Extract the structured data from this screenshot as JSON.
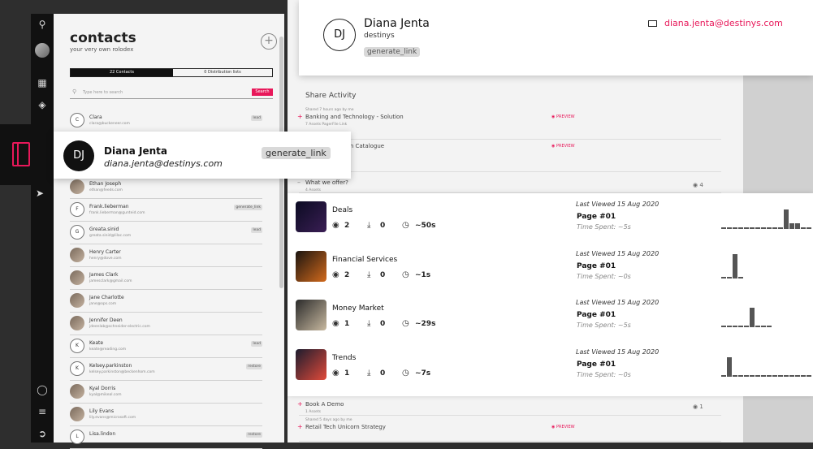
{
  "contacts_panel": {
    "title": "contacts",
    "subtitle": "your very own rolodex",
    "add_icon": "plus-icon",
    "tab_contacts": "22 Contacts",
    "tab_distribution": "0 Distribution lists",
    "search_placeholder": "Type here to search",
    "search_button": "Search",
    "rows": [
      {
        "initial": "C",
        "name": "Clara",
        "email": "clara@buckeneer.com",
        "tag": "lead",
        "photo": false
      },
      {
        "initial": "",
        "name": "Ethan Joseph",
        "email": "ethan@feeds.com",
        "tag": "",
        "photo": true
      },
      {
        "initial": "F",
        "name": "Frank.lieberman",
        "email": "frank.lieberman@gunteid.com",
        "tag": "generate_link",
        "photo": false
      },
      {
        "initial": "G",
        "name": "Greata.sinid",
        "email": "greata.sinid@lilac.com",
        "tag": "lead",
        "photo": false
      },
      {
        "initial": "",
        "name": "Henry Carter",
        "email": "henry@dove.com",
        "tag": "",
        "photo": true
      },
      {
        "initial": "",
        "name": "James Clark",
        "email": "jamesclark@gmail.com",
        "tag": "",
        "photo": true
      },
      {
        "initial": "",
        "name": "Jane Charlotte",
        "email": "jane@ops.com",
        "tag": "",
        "photo": true
      },
      {
        "initial": "",
        "name": "Jennifer Deen",
        "email": "jdeenlab@schneider-electric.com",
        "tag": "",
        "photo": true
      },
      {
        "initial": "K",
        "name": "Keate",
        "email": "keate@reading.com",
        "tag": "lead",
        "photo": false
      },
      {
        "initial": "K",
        "name": "Kelsey.parkinston",
        "email": "kelsey.parkinston@beckenhom.com",
        "tag": "restore",
        "photo": false
      },
      {
        "initial": "",
        "name": "Kyal Dorris",
        "email": "kyal@mikeal.com",
        "tag": "",
        "photo": true
      },
      {
        "initial": "",
        "name": "Lily Evans",
        "email": "lily.evans@microsoft.com",
        "tag": "",
        "photo": true
      },
      {
        "initial": "L",
        "name": "Lisa.lindon",
        "email": "",
        "tag": "restore",
        "photo": false
      }
    ]
  },
  "popup_contact": {
    "initials": "DJ",
    "name": "Diana Jenta",
    "email": "diana.jenta@destinys.com",
    "tag": "generate_link"
  },
  "header": {
    "initials": "DJ",
    "name": "Diana Jenta",
    "company": "destinys",
    "tag": "generate_link",
    "email_icon": "mail-icon",
    "email": "diana.jenta@destinys.com"
  },
  "activity": {
    "heading": "Share Activity",
    "items": [
      {
        "meta": "Shared 7 hours ago by me",
        "title": "Banking and Technology - Solution",
        "sub": "7 Assets    PagerFile Link",
        "preview": "PREVIEW",
        "views": ""
      },
      {
        "meta": "",
        "title": "...eciate - Design Catalogue",
        "sub": "...link",
        "preview": "PREVIEW",
        "views": ""
      },
      {
        "meta": "",
        "title": "What we offer?",
        "sub": "4 Assets",
        "preview": "",
        "views": "4"
      }
    ],
    "bottom_items": [
      {
        "meta": "",
        "title": "Book A Demo",
        "sub": "1 Assets",
        "preview": "",
        "views": "1"
      },
      {
        "meta": "Shared 5 days ago by me",
        "title": "Retail Tech Unicorn Strategy",
        "sub": "",
        "preview": "PREVIEW",
        "views": ""
      }
    ]
  },
  "assets": [
    {
      "name": "Deals",
      "views": "2",
      "downloads": "0",
      "time": "~50s",
      "last_viewed": "Last Viewed 15 Aug 2020",
      "page": "Page #01",
      "time_spent": "Time Spent: ~5s",
      "spark": [
        0,
        0,
        0,
        0,
        0,
        0,
        0,
        0,
        0,
        0,
        0,
        4,
        1,
        1,
        0,
        0
      ],
      "colors": [
        "#0b0b22",
        "#3a1e54"
      ]
    },
    {
      "name": "Financial Services",
      "views": "2",
      "downloads": "0",
      "time": "~1s",
      "last_viewed": "Last Viewed 15 Aug 2020",
      "page": "Page #01",
      "time_spent": "Time Spent: ~0s",
      "spark": [
        0,
        0,
        5,
        0
      ],
      "colors": [
        "#1a1410",
        "#d26a1c"
      ]
    },
    {
      "name": "Money Market",
      "views": "1",
      "downloads": "0",
      "time": "~29s",
      "last_viewed": "Last Viewed 15 Aug 2020",
      "page": "Page #01",
      "time_spent": "Time Spent: ~5s",
      "spark": [
        0,
        0,
        0,
        0,
        0,
        4,
        0,
        0,
        0
      ],
      "colors": [
        "#2a2a2a",
        "#c8b9a0"
      ]
    },
    {
      "name": "Trends",
      "views": "1",
      "downloads": "0",
      "time": "~7s",
      "last_viewed": "Last Viewed 15 Aug 2020",
      "page": "Page #01",
      "time_spent": "Time Spent: ~0s",
      "spark": [
        0,
        4,
        0,
        0,
        0,
        0,
        0,
        0,
        0,
        0,
        0,
        0,
        0,
        0,
        0,
        0
      ],
      "colors": [
        "#1c1c2e",
        "#e14a3a"
      ]
    }
  ],
  "colors": {
    "accent": "#e8185a",
    "rail": "#111111"
  }
}
